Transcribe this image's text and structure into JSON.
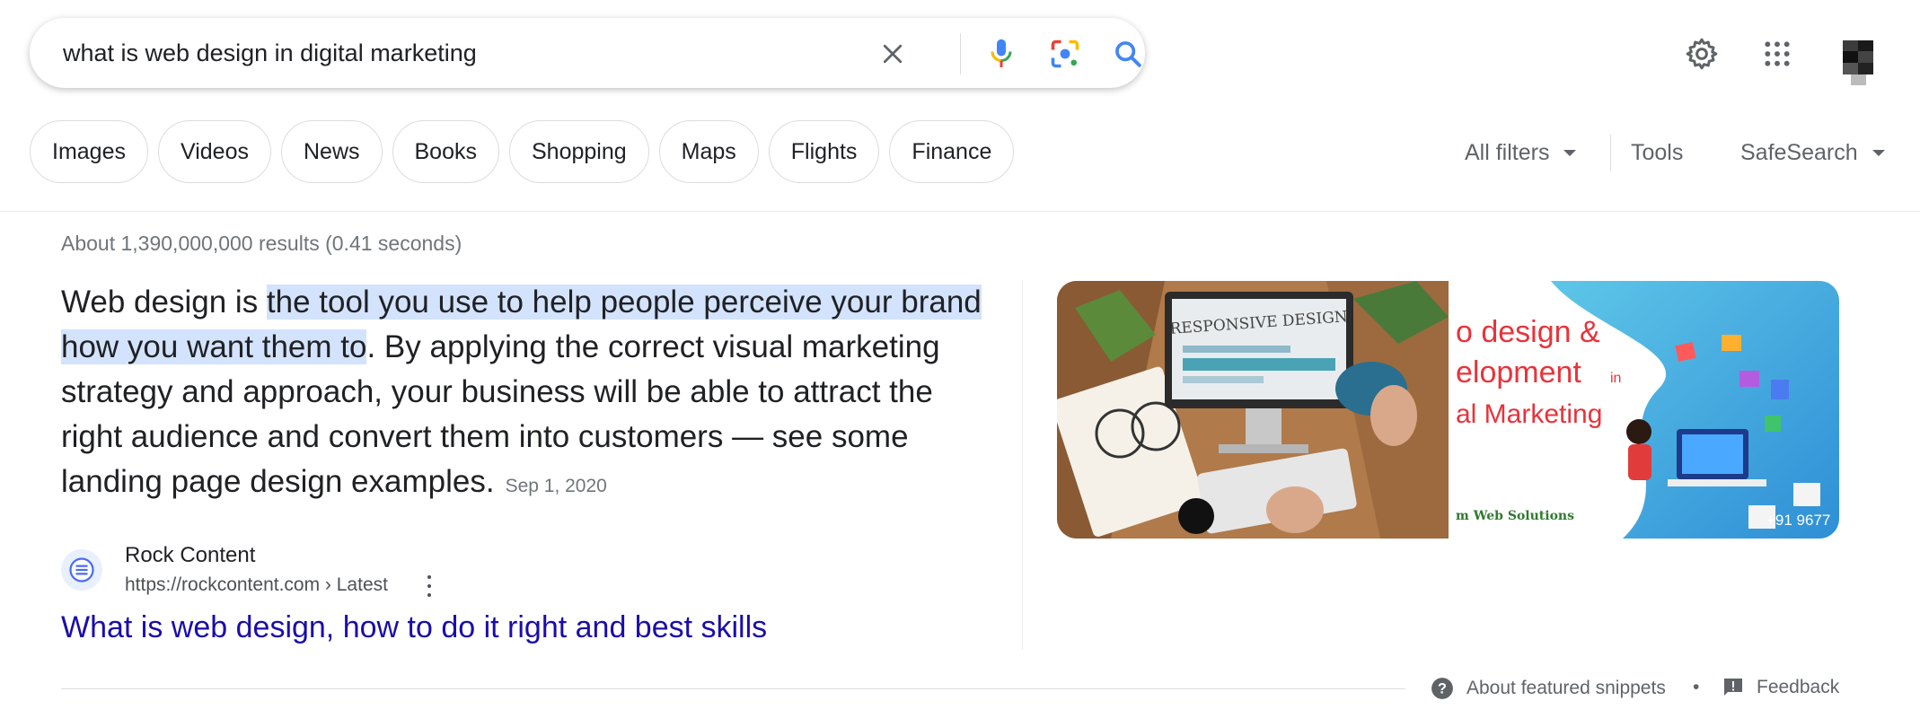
{
  "search": {
    "query": "what is web design in digital marketing"
  },
  "chips": [
    "Images",
    "Videos",
    "News",
    "Books",
    "Shopping",
    "Maps",
    "Flights",
    "Finance"
  ],
  "tools": {
    "all_filters": "All filters",
    "tools": "Tools",
    "safesearch": "SafeSearch"
  },
  "stats": "About 1,390,000,000 results (0.41 seconds)",
  "snippet": {
    "lead": "Web design is ",
    "highlight": "the tool you use to help people perceive your brand how you want them to",
    "rest": ". By applying the correct visual marketing strategy and approach, your business will be able to attract the right audience and convert them into customers — see some landing page design examples.",
    "date": "Sep 1, 2020"
  },
  "source": {
    "name": "Rock Content",
    "url": "https://rockcontent.com › Latest",
    "icon": "document-list-icon"
  },
  "result_title": "What is web design, how to do it right and best skills",
  "images": {
    "image1_text": "RESPONSIVE DESIGN",
    "image2_lines": [
      "o design &",
      "elopment",
      "in",
      "al Marketing"
    ],
    "image2_footer": "m Web Solutions",
    "image2_phone": "+91 9677"
  },
  "footer": {
    "about": "About featured snippets",
    "separator": "•",
    "feedback": "Feedback"
  },
  "colors": {
    "link": "#1a0dab",
    "highlight": "#d3e3fd",
    "google_blue": "#4285f4",
    "google_red": "#ea4335",
    "google_yellow": "#fbbc04",
    "google_green": "#34a853"
  }
}
